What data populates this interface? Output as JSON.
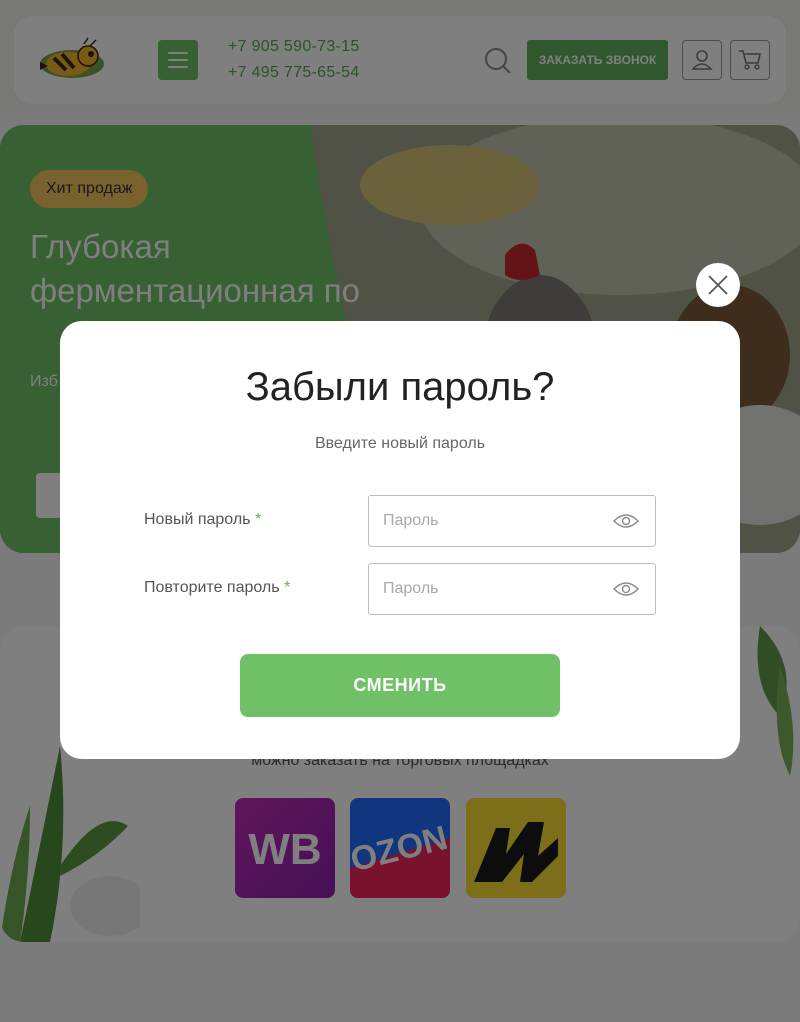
{
  "header": {
    "phones": [
      "+7 905 590-73-15",
      "+7 495 775-65-54"
    ],
    "callback_label": "ЗАКАЗАТЬ ЗВОНОК",
    "icons": {
      "logo": "bee-logo-icon",
      "menu": "burger-menu-icon",
      "search": "search-icon",
      "account": "user-icon",
      "cart": "cart-icon"
    }
  },
  "hero": {
    "badge": "Хит продаж",
    "title": "Глубокая ферментационная по",
    "subtitle": "Изб здо"
  },
  "marketplaces": {
    "subtitle": "можно заказать на торговых площадках",
    "tiles": [
      "WB",
      "OZON",
      "Yandex Market"
    ],
    "tile_text": {
      "wb": "WB",
      "ozon": "OZON"
    }
  },
  "modal": {
    "title": "Забыли пароль?",
    "subtitle": "Введите новый пароль",
    "fields": [
      {
        "label": "Новый пароль",
        "required_mark": "*",
        "placeholder": "Пароль",
        "value": ""
      },
      {
        "label": "Повторите пароль",
        "required_mark": "*",
        "placeholder": "Пароль",
        "value": ""
      }
    ],
    "submit_label": "СМЕНИТЬ",
    "close_icon": "close-icon",
    "eye_icon": "eye-icon"
  },
  "colors": {
    "accent": "#6fc067",
    "accent_dark": "#5fb25a",
    "phone_text": "#55a84f",
    "badge": "#f2c55b",
    "overlay": "rgba(0,0,0,0.5)"
  }
}
